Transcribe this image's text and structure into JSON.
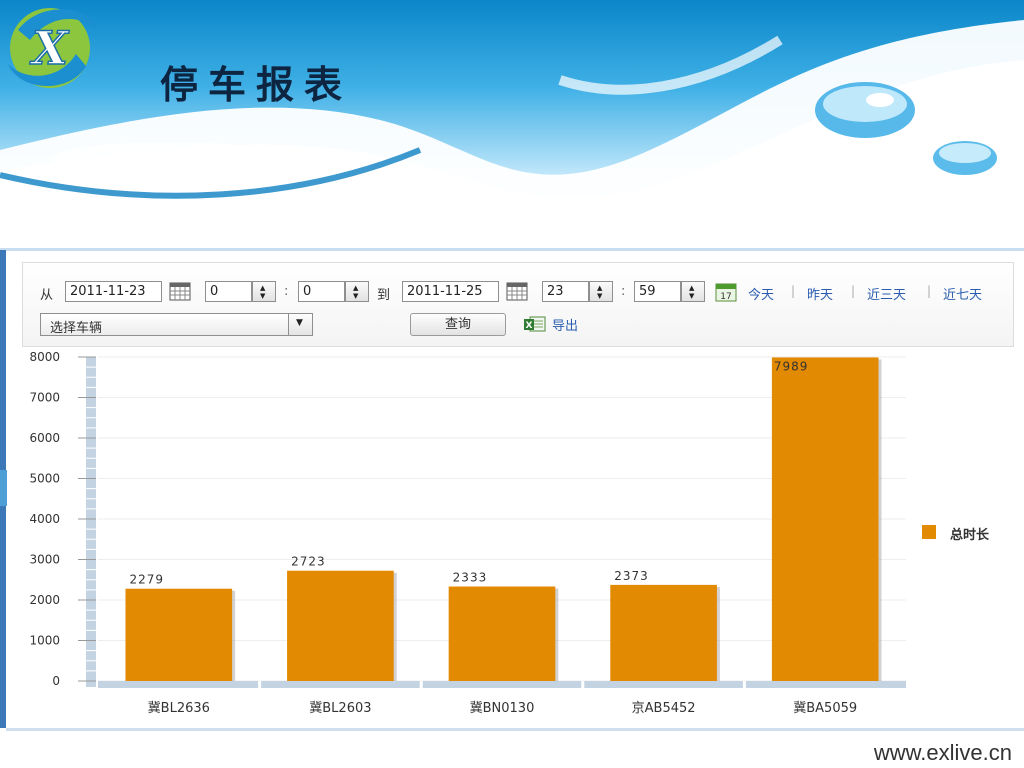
{
  "page": {
    "title": "停车报表",
    "footer_url": "www.exlive.cn"
  },
  "toolbar": {
    "from_label": "从",
    "to_label": "到",
    "time_sep": ":",
    "start_date": "2011-11-23",
    "start_hour": "0",
    "start_minute": "0",
    "end_date": "2011-11-25",
    "end_hour": "23",
    "end_minute": "59",
    "quick_links": [
      "今天",
      "昨天",
      "近三天",
      "近七天"
    ],
    "vehicle_select": "选择车辆",
    "query_label": "查询",
    "export_label": "导出",
    "calendar_day": "17"
  },
  "colors": {
    "bar": "#e38a03",
    "link": "#2a5db0",
    "frame": "#3d78b8"
  },
  "chart_data": {
    "type": "bar",
    "categories": [
      "冀BL2636",
      "冀BL2603",
      "冀BN0130",
      "京AB5452",
      "冀BA5059"
    ],
    "series": [
      {
        "name": "总时长",
        "values": [
          2279,
          2723,
          2333,
          2373,
          7989
        ]
      }
    ],
    "ylim": [
      0,
      8000
    ],
    "yticks": [
      0,
      1000,
      2000,
      3000,
      4000,
      5000,
      6000,
      7000,
      8000
    ],
    "grid": true,
    "legend_position": "right"
  }
}
